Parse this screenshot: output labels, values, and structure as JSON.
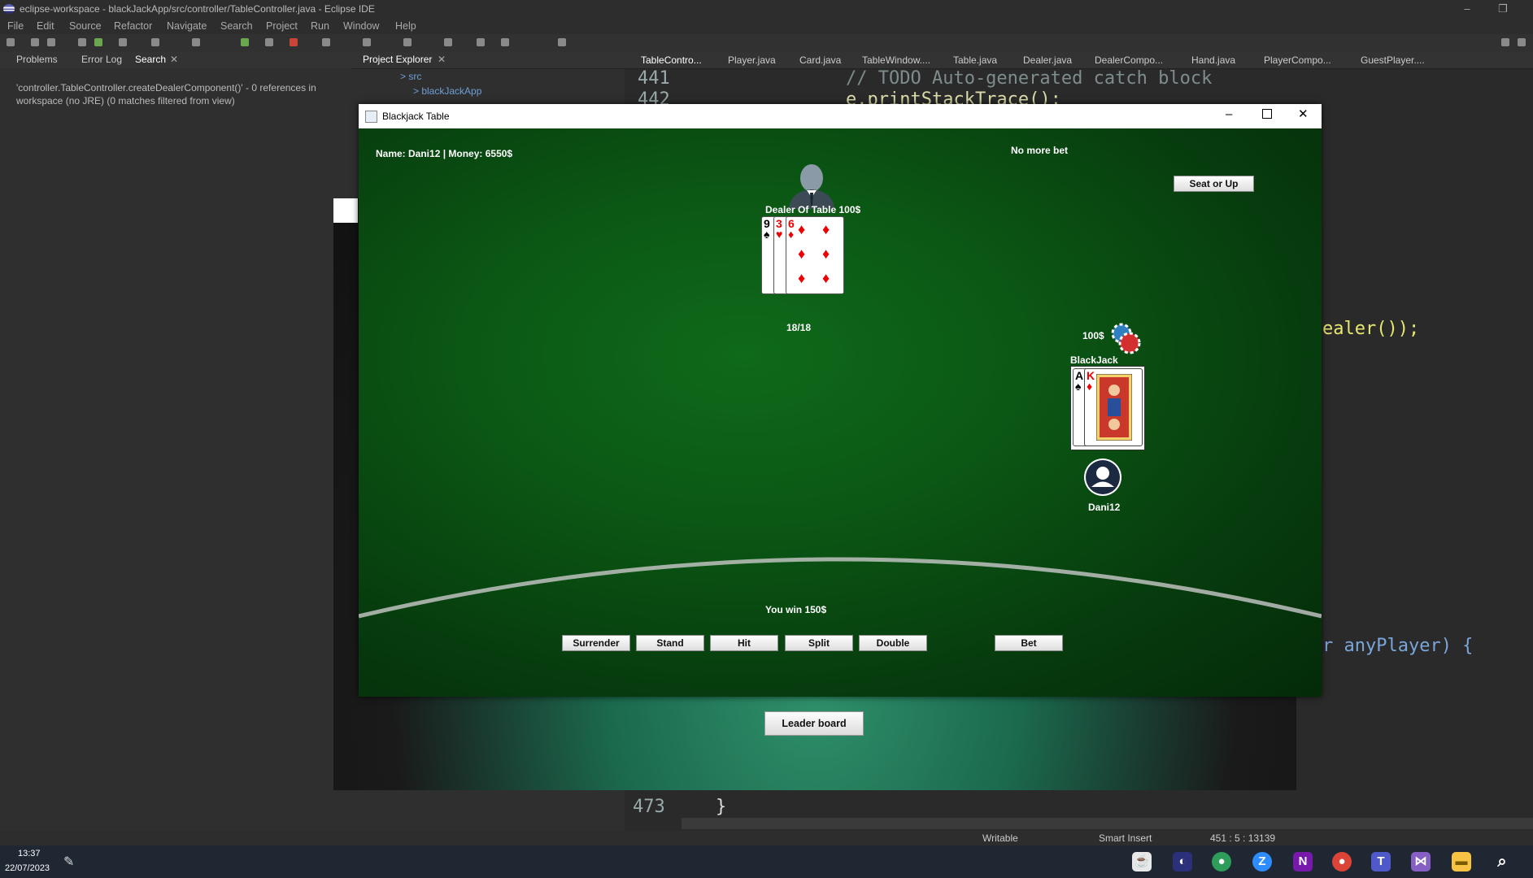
{
  "eclipse": {
    "window_title": "eclipse-workspace - blackJackApp/src/controller/TableController.java - Eclipse IDE",
    "menu": [
      "File",
      "Edit",
      "Source",
      "Refactor",
      "Navigate",
      "Search",
      "Project",
      "Run",
      "Window",
      "Help"
    ],
    "views_left": [
      "Problems",
      "Error Log",
      "Search"
    ],
    "search_result": "'controller.TableController.createDealerComponent()' - 0 references in workspace (no JRE) (0 matches filtered from view)",
    "project_explorer": {
      "tab": "Project Explorer",
      "src": "> src",
      "project": "> blackJackApp"
    },
    "editor_tabs": [
      "TableContro...",
      "Player.java",
      "Card.java",
      "TableWindow....",
      "Table.java",
      "Dealer.java",
      "DealerCompo...",
      "Hand.java",
      "PlayerCompo...",
      "GuestPlayer...."
    ],
    "code_line_1_num": "441",
    "code_line_1": "// TODO Auto-generated catch block",
    "code_line_2_num": "442",
    "code_line_2": "e.printStackTrace();",
    "code_fragment_1": "ealer());",
    "code_fragment_2": "r anyPlayer) {",
    "code_last_num": "473",
    "code_last": "}",
    "status": {
      "writable": "Writable",
      "insert": "Smart Insert",
      "position": "451 : 5 : 13139"
    }
  },
  "taskbar": {
    "time": "13:37",
    "date": "22/07/2023"
  },
  "leader_window": {
    "button": "Leader board"
  },
  "blackjack": {
    "title": "Blackjack Table",
    "player_info": "Name: Dani12 | Money: 6550$",
    "status": "No more bet",
    "seat_button": "Seat or Up",
    "dealer_label": "Dealer Of Table 100$",
    "dealer_score": "18/18",
    "player_bet": "100$",
    "player_result": "BlackJack",
    "player_name": "Dani12",
    "result_message": "You win 150$",
    "actions": [
      "Surrender",
      "Stand",
      "Hit",
      "Split",
      "Double"
    ],
    "bet_button": "Bet",
    "dealer_cards": [
      {
        "rank": "9",
        "suit": "♠"
      },
      {
        "rank": "3",
        "suit": "♥"
      },
      {
        "rank": "6",
        "suit": "♦"
      }
    ],
    "player_cards": [
      {
        "rank": "A",
        "suit": "♠"
      },
      {
        "rank": "K",
        "suit": "♦"
      }
    ]
  }
}
